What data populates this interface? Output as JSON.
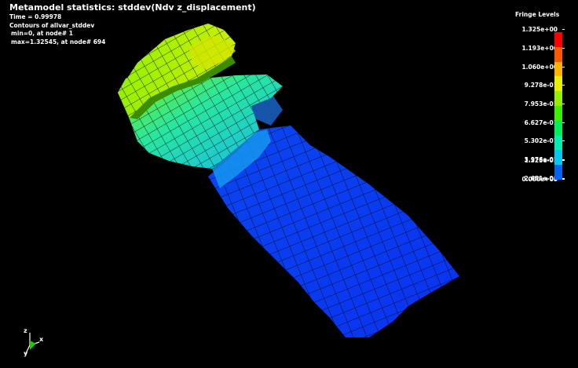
{
  "header": {
    "title": "Metamodel statistics: stddev(Ndv z_displacement)",
    "time_label": "Time = ",
    "time_value": "0.99978",
    "contours": "Contours of allvar_stddev",
    "min_text": "min=0, at node# 1",
    "max_text": "max=1.32545, at node# 694"
  },
  "legend": {
    "title": "Fringe Levels",
    "levels": [
      {
        "value": "1.325e+00",
        "color": "#ff0000"
      },
      {
        "value": "1.193e+00",
        "color": "#ff5a00"
      },
      {
        "value": "1.060e+00",
        "color": "#ffb400"
      },
      {
        "value": "9.278e-01",
        "color": "#e6f000"
      },
      {
        "value": "7.953e-01",
        "color": "#96f000"
      },
      {
        "value": "6.627e-01",
        "color": "#3cf000"
      },
      {
        "value": "5.302e-01",
        "color": "#00f05a"
      },
      {
        "value": "3.976e-01",
        "color": "#00f0b4"
      },
      {
        "value": "2.651e-01",
        "color": "#00c8f0"
      },
      {
        "value": "1.325e-01",
        "color": "#0064f0"
      },
      {
        "value": "0.000e+00",
        "color": "#0000f0"
      }
    ]
  },
  "triad": {
    "x_label": "x",
    "y_label": "y",
    "z_label": "z"
  },
  "colors": {
    "background": "#000000",
    "mesh_line": "#000000",
    "low": "#0a32f0",
    "mid": "#14d2e6",
    "high": "#c8f000"
  }
}
